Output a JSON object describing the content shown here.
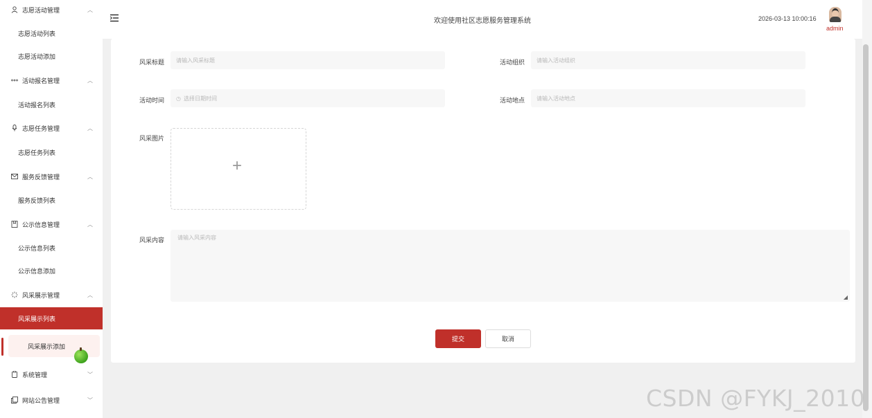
{
  "sidebar": {
    "groups": [
      {
        "label": "志愿活动管理",
        "icon": "user-icon",
        "items": [
          "志愿活动列表",
          "志愿活动添加"
        ]
      },
      {
        "label": "活动报名管理",
        "icon": "more-dots-icon",
        "items": [
          "活动报名列表"
        ]
      },
      {
        "label": "志愿任务管理",
        "icon": "microphone-icon",
        "items": [
          "志愿任务列表"
        ]
      },
      {
        "label": "服务反馈管理",
        "icon": "mail-icon",
        "items": [
          "服务反馈列表"
        ]
      },
      {
        "label": "公示信息管理",
        "icon": "notebook-icon",
        "items": [
          "公示信息列表",
          "公示信息添加"
        ]
      },
      {
        "label": "风采展示管理",
        "icon": "loading-icon",
        "items": [
          "风采展示列表",
          "风采展示添加"
        ]
      },
      {
        "label": "系统管理",
        "icon": "clipboard-icon",
        "items": []
      },
      {
        "label": "网站公告管理",
        "icon": "copy-document-icon",
        "items": []
      }
    ]
  },
  "header": {
    "welcome": "欢迎使用社区志愿服务管理系统",
    "datetime": "2026-03-13 10:00:16",
    "username": "admin"
  },
  "form": {
    "title_label": "风采标题",
    "title_placeholder": "请输入风采标题",
    "org_label": "活动组织",
    "org_placeholder": "请输入活动组织",
    "time_label": "活动时间",
    "time_placeholder": "选择日期时间",
    "place_label": "活动地点",
    "place_placeholder": "请输入活动地点",
    "image_label": "风采图片",
    "content_label": "风采内容",
    "content_placeholder": "请输入风采内容",
    "submit": "提交",
    "cancel": "取消"
  },
  "watermark": "CSDN @FYKJ_2010"
}
